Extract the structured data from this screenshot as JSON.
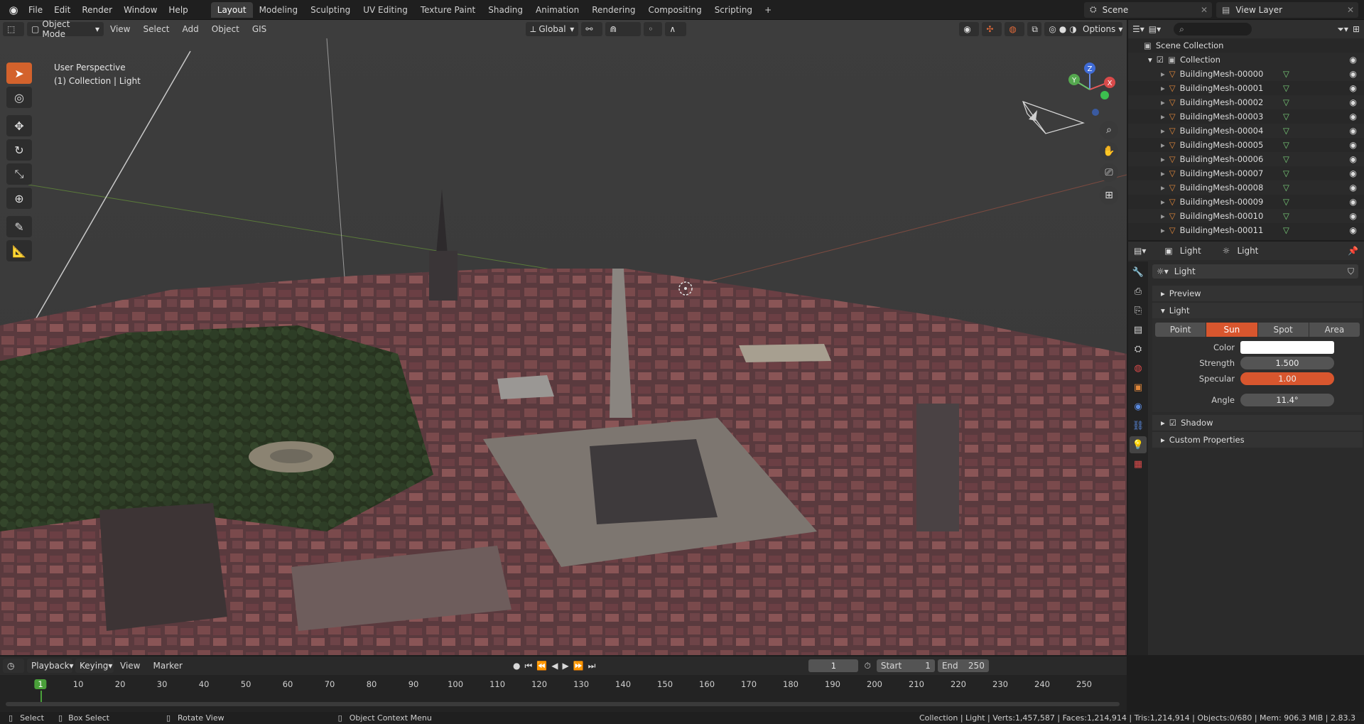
{
  "topbar": {
    "menus": [
      "File",
      "Edit",
      "Render",
      "Window",
      "Help"
    ],
    "workspaces": [
      "Layout",
      "Modeling",
      "Sculpting",
      "UV Editing",
      "Texture Paint",
      "Shading",
      "Animation",
      "Rendering",
      "Compositing",
      "Scripting"
    ],
    "active_workspace": "Layout",
    "add_label": "+",
    "scene": "Scene",
    "view_layer": "View Layer"
  },
  "viewport_header": {
    "mode": "Object Mode",
    "menus": [
      "View",
      "Select",
      "Add",
      "Object",
      "GIS"
    ],
    "transform_orientation": "Global",
    "options": "Options"
  },
  "viewport": {
    "perspective": "User Perspective",
    "context": "(1) Collection | Light",
    "gizmo": {
      "x": "X",
      "y": "Y",
      "z": "Z"
    }
  },
  "toolbar": {
    "tools": [
      "select-box",
      "cursor",
      "move",
      "rotate",
      "scale",
      "transform",
      "annotate",
      "measure"
    ]
  },
  "outliner": {
    "root": "Scene Collection",
    "collection": "Collection",
    "items": [
      "BuildingMesh-00000",
      "BuildingMesh-00001",
      "BuildingMesh-00002",
      "BuildingMesh-00003",
      "BuildingMesh-00004",
      "BuildingMesh-00005",
      "BuildingMesh-00006",
      "BuildingMesh-00007",
      "BuildingMesh-00008",
      "BuildingMesh-00009",
      "BuildingMesh-00010",
      "BuildingMesh-00011"
    ]
  },
  "properties": {
    "breadcrumb_object": "Light",
    "breadcrumb_data": "Light",
    "datablock": "Light",
    "panels": {
      "preview": "Preview",
      "light": "Light",
      "shadow": "Shadow",
      "custom": "Custom Properties"
    },
    "light_types": [
      "Point",
      "Sun",
      "Spot",
      "Area"
    ],
    "active_type": "Sun",
    "color_label": "Color",
    "strength_label": "Strength",
    "strength": "1.500",
    "specular_label": "Specular",
    "specular": "1.00",
    "angle_label": "Angle",
    "angle": "11.4°"
  },
  "timeline": {
    "menus": [
      "Playback",
      "Keying",
      "View",
      "Marker"
    ],
    "current_frame": "1",
    "start_label": "Start",
    "start": "1",
    "end_label": "End",
    "end": "250",
    "ticks": [
      "1",
      "10",
      "20",
      "30",
      "40",
      "50",
      "60",
      "70",
      "80",
      "90",
      "100",
      "110",
      "120",
      "130",
      "140",
      "150",
      "160",
      "170",
      "180",
      "190",
      "200",
      "210",
      "220",
      "230",
      "240",
      "250"
    ]
  },
  "statusbar": {
    "select": "Select",
    "box_select": "Box Select",
    "rotate_view": "Rotate View",
    "context_menu": "Object Context Menu",
    "stats": "Collection | Light | Verts:1,457,587 | Faces:1,214,914 | Tris:1,214,914 | Objects:0/680 | Mem: 906.3 MiB | 2.83.3"
  },
  "colors": {
    "accent": "#d3622c",
    "sun_active": "#d8562e",
    "specular_field": "#d8562e"
  }
}
